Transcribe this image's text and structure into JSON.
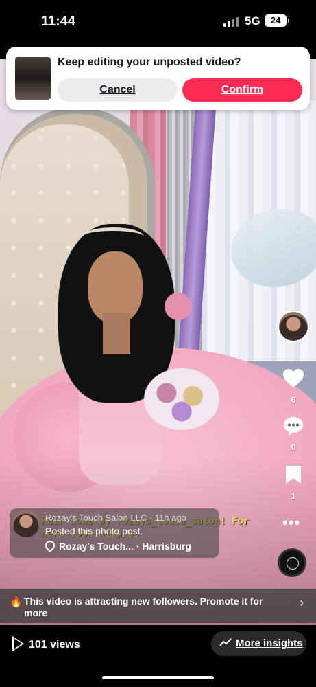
{
  "status_bar": {
    "time": "11:44",
    "network": "5G",
    "battery": "24"
  },
  "banner": {
    "title": "Keep editing your unposted video?",
    "cancel_label": "Cancel",
    "confirm_label": "Confirm",
    "confirm_color": "#fe2c55"
  },
  "rail": {
    "like_count": "6",
    "comment_count": "0",
    "save_count": "1",
    "more_label": "•••"
  },
  "post": {
    "overlay_text": "Hair done by rozays_touch_salon! For next look with us",
    "author_and_time": "Rozay's Touch Salon LLC · 11h ago",
    "label": "Posted this photo post.",
    "location": "Rozay's Touch... · Harrisburg"
  },
  "promote": {
    "text": "This video is attracting new followers. Promote it for more",
    "icon": "flame-icon",
    "chevron": "›"
  },
  "bottom": {
    "views": "101 views",
    "insights_label": "More insights"
  }
}
